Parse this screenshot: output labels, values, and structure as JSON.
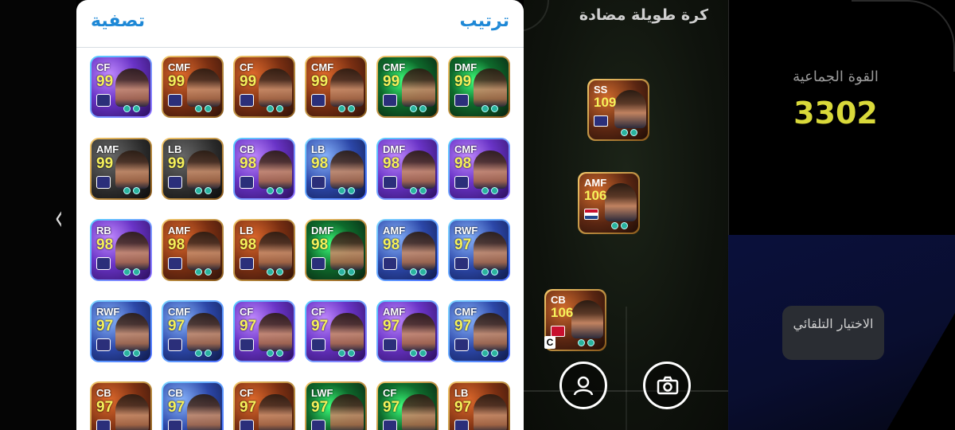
{
  "panel": {
    "filter_label": "تصفية",
    "sort_label": "ترتيب"
  },
  "icons": {
    "back": "chevron-left-icon",
    "profile": "person-icon",
    "camera": "camera-icon"
  },
  "grid": [
    [
      {
        "pos": "CF",
        "rating": "99",
        "theme": "purple"
      },
      {
        "pos": "CMF",
        "rating": "99",
        "theme": "gold"
      },
      {
        "pos": "CF",
        "rating": "99",
        "theme": "gold"
      },
      {
        "pos": "CMF",
        "rating": "99",
        "theme": "gold"
      },
      {
        "pos": "CMF",
        "rating": "99",
        "theme": "green"
      },
      {
        "pos": "DMF",
        "rating": "99",
        "theme": "green"
      }
    ],
    [
      {
        "pos": "AMF",
        "rating": "99",
        "theme": "dark"
      },
      {
        "pos": "LB",
        "rating": "99",
        "theme": "dark"
      },
      {
        "pos": "CB",
        "rating": "98",
        "theme": "purple"
      },
      {
        "pos": "LB",
        "rating": "98",
        "theme": "blue"
      },
      {
        "pos": "DMF",
        "rating": "98",
        "theme": "purple"
      },
      {
        "pos": "CMF",
        "rating": "98",
        "theme": "purple"
      }
    ],
    [
      {
        "pos": "RB",
        "rating": "98",
        "theme": "purple"
      },
      {
        "pos": "AMF",
        "rating": "98",
        "theme": "gold"
      },
      {
        "pos": "LB",
        "rating": "98",
        "theme": "gold"
      },
      {
        "pos": "DMF",
        "rating": "98",
        "theme": "green"
      },
      {
        "pos": "AMF",
        "rating": "98",
        "theme": "blue"
      },
      {
        "pos": "RWF",
        "rating": "97",
        "theme": "blue"
      }
    ],
    [
      {
        "pos": "RWF",
        "rating": "97",
        "theme": "blue"
      },
      {
        "pos": "CMF",
        "rating": "97",
        "theme": "blue"
      },
      {
        "pos": "CF",
        "rating": "97",
        "theme": "purple"
      },
      {
        "pos": "CF",
        "rating": "97",
        "theme": "purple"
      },
      {
        "pos": "AMF",
        "rating": "97",
        "theme": "purple"
      },
      {
        "pos": "CMF",
        "rating": "97",
        "theme": "blue"
      }
    ],
    [
      {
        "pos": "CB",
        "rating": "97",
        "theme": "gold"
      },
      {
        "pos": "CB",
        "rating": "97",
        "theme": "blue"
      },
      {
        "pos": "CF",
        "rating": "97",
        "theme": "gold"
      },
      {
        "pos": "LWF",
        "rating": "97",
        "theme": "green"
      },
      {
        "pos": "CF",
        "rating": "97",
        "theme": "green"
      },
      {
        "pos": "LB",
        "rating": "97",
        "theme": "gold"
      }
    ]
  ],
  "pitch": {
    "title": "كرة طويلة مضادة",
    "cards": [
      {
        "pos": "SS",
        "rating": "109"
      },
      {
        "pos": "AMF",
        "rating": "106"
      },
      {
        "pos": "CB",
        "rating": "106"
      }
    ],
    "captain_marker": "C"
  },
  "team": {
    "strength_label": "القوة الجماعية",
    "strength_value": "3302",
    "auto_select_label": "الاختيار التلقائي"
  },
  "colors": {
    "accent_blue": "#1e88d6",
    "rating_yellow": "#f6f15b",
    "strength_yellow": "#d9d93a"
  }
}
